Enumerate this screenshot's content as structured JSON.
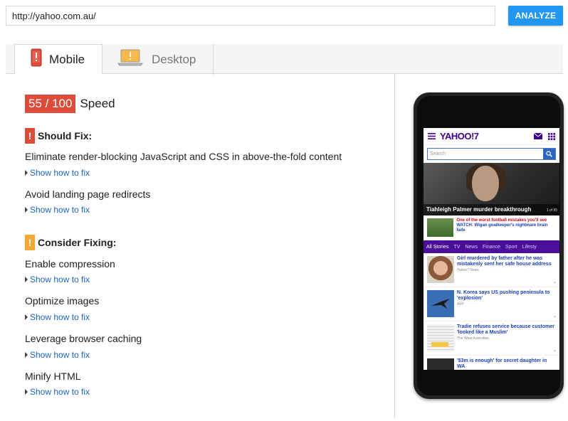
{
  "top_bar": {
    "url_value": "http://yahoo.com.au/",
    "analyze_label": "ANALYZE"
  },
  "tabs": [
    {
      "label": "Mobile",
      "icon": "mobile-warning-icon",
      "active": true
    },
    {
      "label": "Desktop",
      "icon": "laptop-warning-icon",
      "active": false
    }
  ],
  "score": {
    "value": "55 / 100",
    "label": "Speed",
    "color": "#dd4b39"
  },
  "should_fix": {
    "heading": "Should Fix:",
    "icon_glyph": "!",
    "color": "#dd4b39",
    "rules": [
      {
        "title": "Eliminate render-blocking JavaScript and CSS in above-the-fold content",
        "link": "Show how to fix"
      },
      {
        "title": "Avoid landing page redirects",
        "link": "Show how to fix"
      }
    ]
  },
  "consider_fixing": {
    "heading": "Consider Fixing:",
    "icon_glyph": "!",
    "color": "#f4a732",
    "rules": [
      {
        "title": "Enable compression",
        "link": "Show how to fix"
      },
      {
        "title": "Optimize images",
        "link": "Show how to fix"
      },
      {
        "title": "Leverage browser caching",
        "link": "Show how to fix"
      },
      {
        "title": "Minify HTML",
        "link": "Show how to fix"
      }
    ]
  },
  "phone_preview": {
    "logo": "YAHOO!7",
    "search_placeholder": "Search",
    "hero_caption": "Tiahleigh Palmer murder breakthrough",
    "hero_count": "1 of 95",
    "promo_red": "One of the worst football mistakes you'll see",
    "promo_blue": "WATCH: Wigan goalkeeper's nightmare brain fade",
    "nav": [
      "All Stories",
      "TV",
      "News",
      "Finance",
      "Sport",
      "Lifesty"
    ],
    "stories": [
      {
        "title": "Girl murdered by father after he was mistakenly sent her safe house address",
        "source": "Yahoo7 News"
      },
      {
        "title": "N. Korea says US pushing peninsula to 'explosion'",
        "source": "AFP"
      },
      {
        "title": "Tradie refuses service because customer 'looked like a Muslim'",
        "source": "The West Australian"
      },
      {
        "title": "'$3m is enough' for secret daughter in WA",
        "source": ""
      }
    ]
  }
}
